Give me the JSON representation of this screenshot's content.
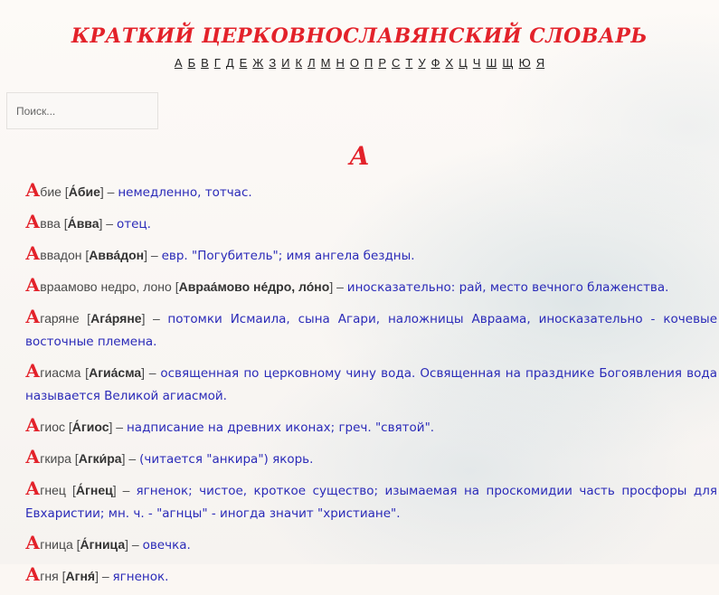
{
  "site": {
    "title": "КРАТКИЙ ЦЕРКОВНОСЛАВЯНСКИЙ СЛОВАРЬ",
    "alphabet": [
      "А",
      "Б",
      "В",
      "Г",
      "Д",
      "Е",
      "Ж",
      "З",
      "И",
      "К",
      "Л",
      "М",
      "Н",
      "О",
      "П",
      "Р",
      "С",
      "Т",
      "У",
      "Ф",
      "Х",
      "Ц",
      "Ч",
      "Ш",
      "Щ",
      "Ю",
      "Я"
    ]
  },
  "search": {
    "placeholder": "Поиск..."
  },
  "section": {
    "letter": "А"
  },
  "colors": {
    "accent_red": "#e3222a",
    "definition_blue": "#2a2ab8"
  },
  "entries": [
    {
      "cap": "А",
      "rest": "бие",
      "accent": "А́бие",
      "def": "немедленно, тотчас."
    },
    {
      "cap": "А",
      "rest": "вва",
      "accent": "А́вва",
      "def": "отец."
    },
    {
      "cap": "А",
      "rest": "ввадон",
      "accent": "Авва́дон",
      "def": "евр. \"Погубитель\"; имя ангела бездны."
    },
    {
      "cap": "А",
      "rest": "враамово недро, лоно",
      "accent": "Авраа́мово не́дро, ло́но",
      "def": "иносказательно: рай, место вечного блаженства."
    },
    {
      "cap": "А",
      "rest": "гаряне",
      "accent": "Ага́ряне",
      "def": "потомки Исмаила, сына Агари, наложницы Авраама, иносказательно - кочевые восточные племена."
    },
    {
      "cap": "А",
      "rest": "гиасма",
      "accent": "Агиа́сма",
      "def": "освященная по церковному чину вода. Освященная на празднике Богоявления вода называется Великой агиасмой."
    },
    {
      "cap": "А",
      "rest": "гиос",
      "accent": "А́гиос",
      "def": "надписание на древних иконах; греч. \"святой\"."
    },
    {
      "cap": "А",
      "rest": "гкира",
      "accent": "Агки́ра",
      "def": "(читается \"анкира\") якорь."
    },
    {
      "cap": "А",
      "rest": "гнец",
      "accent": "А́гнец",
      "def": "ягненок; чистое, кроткое существо; изымаемая на проскомидии часть просфоры для Евхаристии; мн. ч. - \"агнцы\" - иногда значит \"христиане\"."
    },
    {
      "cap": "А",
      "rest": "гница",
      "accent": "А́гница",
      "def": "овечка."
    },
    {
      "cap": "А",
      "rest": "гня",
      "accent": "Агня́",
      "def": "ягненок."
    }
  ]
}
